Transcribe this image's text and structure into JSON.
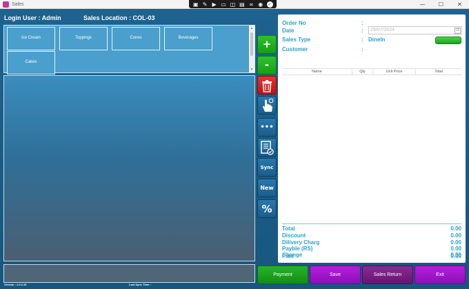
{
  "window": {
    "title": "Sales",
    "controls": {
      "minimize": "—",
      "maximize": "☐",
      "close": "✕"
    }
  },
  "floating_toolbar": {
    "icons": [
      "screen-record-icon",
      "notes-icon",
      "camera-icon",
      "chat-icon",
      "crop-icon",
      "window-capture-icon",
      "link-icon",
      "circle-icon",
      "check-icon"
    ]
  },
  "header": {
    "login_user": "Login User :  Admin",
    "sales_location": "Sales Location  :  COL-03"
  },
  "categories": [
    "Ice Cream",
    "Toppings",
    "Cones",
    "Beverages",
    "Cakes"
  ],
  "side_buttons": {
    "add": "+",
    "subtract": "-",
    "sync": "Sync",
    "new": "New",
    "percent": "%",
    "more": "•••"
  },
  "order": {
    "order_no_label": "Order No",
    "date_label": "Date",
    "date_value": "29/07/2024",
    "sales_type_label": "Sales Type",
    "sales_type_value": "DineIn",
    "customer_label": "Customer",
    "colon": ":",
    "columns": [
      "Name",
      "Qty",
      "Unit Price",
      "Total"
    ]
  },
  "totals": [
    {
      "label": "Total",
      "value": "0.00"
    },
    {
      "label": "Discount",
      "value": "0.00"
    },
    {
      "label": "Dilivery Charg",
      "value": "0.00"
    },
    {
      "label": "Payble (RS)",
      "value": "0.00"
    },
    {
      "label": "Paid",
      "value": "0.00"
    },
    {
      "label": "Change",
      "value": "0.00"
    }
  ],
  "footer": {
    "version": "Version : 1.0.2.16",
    "last_sync": "Last Sync Time :"
  },
  "actions": {
    "payment": "Payment",
    "save": "Save",
    "sales_return": "Sales Return",
    "exit": "Exit"
  },
  "colors": {
    "background": "#1d6390",
    "accent_text": "#2aa0c8",
    "green": "#1da21d",
    "red": "#c61010",
    "violet": "#8c0fb6",
    "purple": "#6a1474"
  }
}
